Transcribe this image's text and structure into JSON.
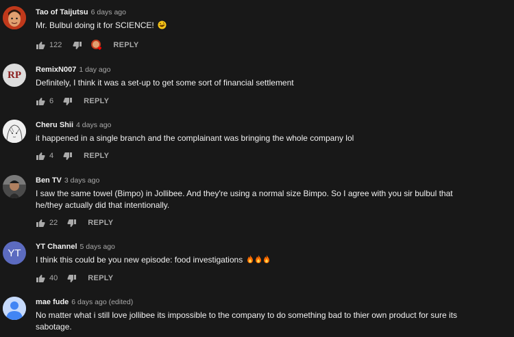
{
  "reply_label": "REPLY",
  "comments": [
    {
      "author": "Tao of Taijutsu",
      "time": "6 days ago",
      "text": "Mr. Bulbul doing it for SCIENCE!",
      "likes": "122",
      "avatar_color": "#c0391b",
      "emoji": "rolling-on-floor-laughing-emoji"
    },
    {
      "author": "RemixN007",
      "time": "1 day ago",
      "text": "Definitely, I think it was a set-up to get some sort of financial settlement",
      "likes": "6",
      "avatar_initials": "RP",
      "avatar_color": "#8a1c1c"
    },
    {
      "author": "Cheru Shii",
      "time": "4 days ago",
      "text": "it happened in a single branch and the complainant was bringing the whole company lol",
      "likes": "4",
      "avatar_color": "#e8e8e8"
    },
    {
      "author": "Ben TV",
      "time": "3 days ago",
      "text": "I saw the same towel (Bimpo) in Jollibee.  And they're using a normal size Bimpo. So I agree with you sir bulbul that he/they actually did that intentionally.",
      "likes": "22",
      "avatar_color": "#5a5a5a"
    },
    {
      "author": "YT Channel",
      "time": "5 days ago",
      "text": "I think this could be you new episode: food investigations",
      "likes": "40",
      "avatar_initials": "YT",
      "avatar_color": "#5c6bc0",
      "emoji": "fire-emoji x3"
    },
    {
      "author": "mae fude",
      "time": "6 days ago (edited)",
      "text": "No matter what i still love jollibee its impossible to the company to do something bad to thier own product for sure its sabotage.",
      "avatar_color": "#4285f4"
    }
  ]
}
